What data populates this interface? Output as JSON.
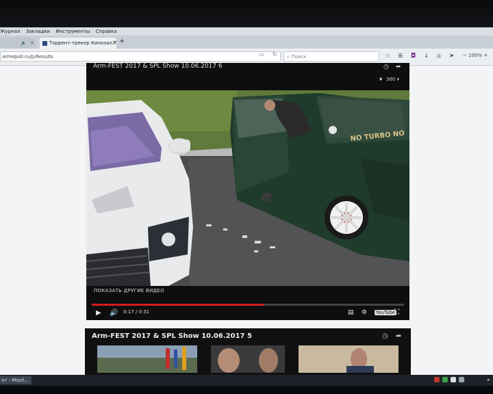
{
  "menubar": {
    "items": [
      "Журнал",
      "Закладки",
      "Инструменты",
      "Справка"
    ]
  },
  "tabs": [
    {
      "label": ""
    },
    {
      "label": "Торрент-трекер Кинозал.ТВ"
    }
  ],
  "navbar": {
    "url": "armepoll.ru/p/Results",
    "search_placeholder": "Поиск",
    "zoom": "100%"
  },
  "player": {
    "title": "Arm-FEST 2017 & SPL Show 10.06.2017 6",
    "quality": "360",
    "plate_text": "NO TURBO NO",
    "show_more": "ПОКАЗАТЬ ДРУГИЕ ВИДЕО",
    "time": "0:17 / 0:31",
    "progress": 0.55,
    "youtube_label": "YouTube"
  },
  "next_card": {
    "title": "Arm-FEST 2017 & SPL Show 10.06.2017 5"
  },
  "taskbar": {
    "task_label": "ат - Mozil..."
  },
  "colors": {
    "progress_fill": "#d31d1d",
    "player_bg": "#0e0e0f",
    "car_green": "#1f3b2b"
  }
}
